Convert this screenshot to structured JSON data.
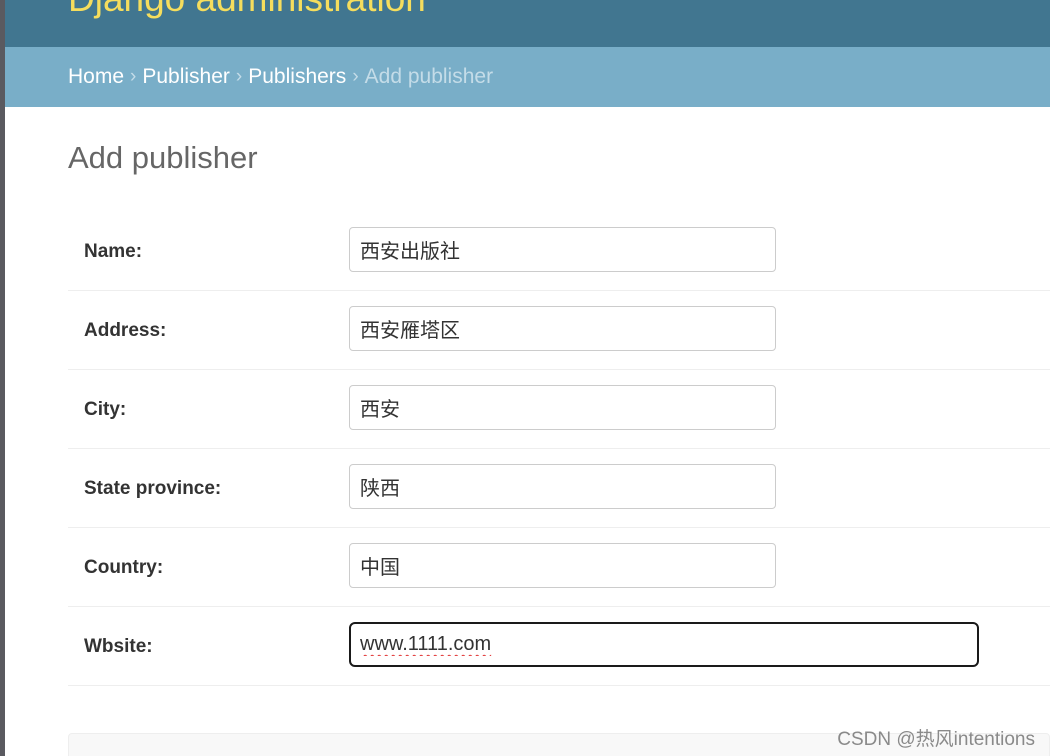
{
  "header": {
    "branding": "Django administration"
  },
  "breadcrumbs": {
    "home": "Home",
    "app": "Publisher",
    "model": "Publishers",
    "current": "Add publisher",
    "separator": "›"
  },
  "page": {
    "title": "Add publisher"
  },
  "form": {
    "fields": [
      {
        "label": "Name:",
        "value": "西安出版社"
      },
      {
        "label": "Address:",
        "value": "西安雁塔区"
      },
      {
        "label": "City:",
        "value": "西安"
      },
      {
        "label": "State province:",
        "value": "陕西"
      },
      {
        "label": "Country:",
        "value": "中国"
      },
      {
        "label": "Wbsite:",
        "value": "www.1111.com"
      }
    ]
  },
  "watermark": "CSDN @热风intentions",
  "colors": {
    "header_bg": "#417690",
    "branding_text": "#f5dd5d",
    "breadcrumbs_bg": "#79aec8"
  }
}
